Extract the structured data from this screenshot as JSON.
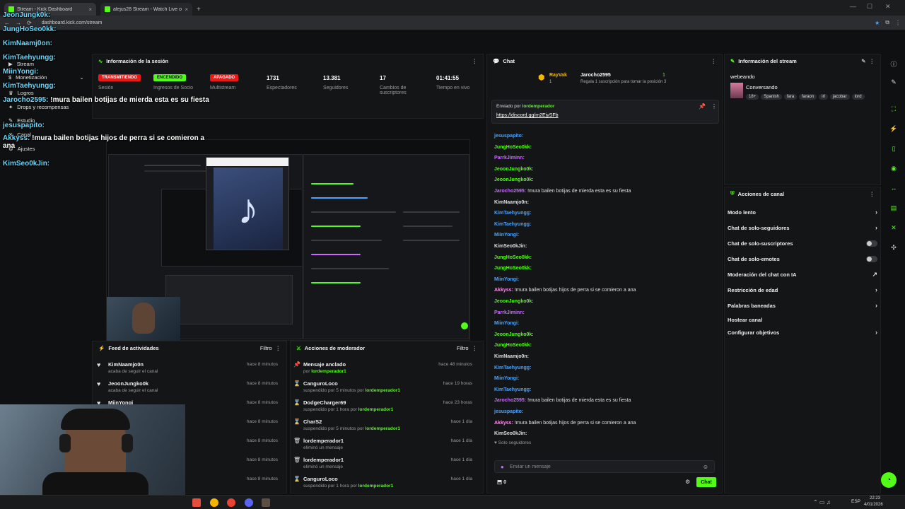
{
  "browser": {
    "tabs": [
      {
        "title": "Stream - Kick Dashboard",
        "active": true
      },
      {
        "title": "alejus28 Stream - Watch Live o...",
        "active": false
      }
    ],
    "url": "dashboard.kick.com/stream"
  },
  "session": {
    "title": "Información de la sesión",
    "stats": [
      {
        "value": "TRANSMITIENDO",
        "label": "Sesión",
        "kind": "red"
      },
      {
        "value": "ENCENDIDO",
        "label": "Ingresos de Socio",
        "kind": "grn"
      },
      {
        "value": "APAGADO",
        "label": "Multistream",
        "kind": "red"
      },
      {
        "value": "1731",
        "label": "Espectadores"
      },
      {
        "value": "13.381",
        "label": "Seguidores"
      },
      {
        "value": "17",
        "label": "Cambios de suscriptores"
      },
      {
        "value": "01:41:55",
        "label": "Tiempo en vivo"
      }
    ]
  },
  "nav": {
    "items": [
      "Stream",
      "Monetización",
      "Logros",
      "Drops y recompensas",
      "Estudio",
      "Canal",
      "Ajustes"
    ]
  },
  "overlay_chat": [
    {
      "user": "JeonJungk0k:",
      "msg": ""
    },
    {
      "user": "JungHoSeo0kk:",
      "msg": ""
    },
    {
      "user": "KimNaamj0on:",
      "msg": ""
    },
    {
      "user": "KimTaehyungg:",
      "msg": ""
    },
    {
      "user": "MiinYongi:",
      "msg": ""
    },
    {
      "user": "KimTaehyungg:",
      "msg": ""
    },
    {
      "user": "Jarocho2595:",
      "msg": "!mura bailen botijas de mierda esta es su fiesta"
    },
    {
      "user": "jesuspapito:",
      "msg": ""
    },
    {
      "user": "Akkyss:",
      "msg": "!mura bailen botijas hijos de perra si se comieron a ana"
    },
    {
      "user": "KimSeo0kJin:",
      "msg": ""
    }
  ],
  "feed": {
    "title": "Feed de actividades",
    "filter": "Filtro",
    "items": [
      {
        "name": "KimNaamjo0n",
        "sub": "acaba de seguir el canal",
        "time": "hace 8 minutos"
      },
      {
        "name": "JeoonJungko0k",
        "sub": "acaba de seguir el canal",
        "time": "hace 8 minutos"
      },
      {
        "name": "MiinYongi",
        "sub": "",
        "time": "hace 8 minutos"
      },
      {
        "name": "",
        "sub": "",
        "time": "hace 8 minutos"
      },
      {
        "name": "",
        "sub": "",
        "time": "hace 8 minutos"
      },
      {
        "name": "",
        "sub": "",
        "time": "hace 8 minutos"
      },
      {
        "name": "",
        "sub": "",
        "time": "hace 8 minutos"
      }
    ]
  },
  "mod": {
    "title": "Acciones de moderador",
    "filter": "Filtro",
    "items": [
      {
        "icon": "pin-icon",
        "name": "Mensaje anclado",
        "sub": "por",
        "who": "lordemperador1",
        "time": "hace 48 minutos"
      },
      {
        "icon": "hourglass-icon",
        "name": "CanguroLoco",
        "sub": "suspendido por 5 minutos por",
        "who": "lordemperador1",
        "time": "hace 19 horas"
      },
      {
        "icon": "hourglass-icon",
        "name": "DodgeCharger69",
        "sub": "suspendido por 1 hora por",
        "who": "lordemperador1",
        "time": "hace 23 horas"
      },
      {
        "icon": "hourglass-icon",
        "name": "CharS2",
        "sub": "suspendido por 5 minutos por",
        "who": "lordemperador1",
        "time": "hace 1 día"
      },
      {
        "icon": "trash-icon",
        "name": "lordemperador1",
        "sub": "eliminó un mensaje",
        "who": "",
        "time": "hace 1 día"
      },
      {
        "icon": "trash-icon",
        "name": "lordemperador1",
        "sub": "eliminó un mensaje",
        "who": "",
        "time": "hace 1 día"
      },
      {
        "icon": "hourglass-icon",
        "name": "CanguroLoco",
        "sub": "suspendido por 1 hora por",
        "who": "lordemperador1",
        "time": "hace 1 día"
      }
    ]
  },
  "chat": {
    "title": "Chat",
    "gifter": {
      "name": "RayVak",
      "count": "1",
      "top": "Jarocho2595",
      "top_count": "1",
      "hint": "Regala 1 suscripción para tomar la posición 3"
    },
    "pinned": {
      "label": "Enviado por",
      "by": "lordemperador",
      "link": "https://discord.gg/m2EjySFb"
    },
    "messages": [
      {
        "user": "jesuspapito:",
        "color": "#4aa3ff",
        "msg": ""
      },
      {
        "user": "JungHoSeo0kk:",
        "color": "#53fc18",
        "msg": ""
      },
      {
        "user": "ParrkJiminn:",
        "color": "#c86bff",
        "msg": ""
      },
      {
        "user": "JeoonJungko0k:",
        "color": "#53fc18",
        "msg": ""
      },
      {
        "user": "JeoonJungko0k:",
        "color": "#53fc18",
        "msg": ""
      },
      {
        "user": "Jarocho2595:",
        "color": "#c86bff",
        "msg": "!mura bailen botijas de mierda esta es su fiesta"
      },
      {
        "user": "KimNaamjo0n:",
        "color": "#e0e0e0",
        "msg": ""
      },
      {
        "user": "KimTaehyungg:",
        "color": "#4aa3ff",
        "msg": ""
      },
      {
        "user": "KimTaehyungg:",
        "color": "#4aa3ff",
        "msg": ""
      },
      {
        "user": "MiinYongi:",
        "color": "#4aa3ff",
        "msg": ""
      },
      {
        "user": "KimSeo0kJin:",
        "color": "#e0e0e0",
        "msg": ""
      },
      {
        "user": "JungHoSeo0kk:",
        "color": "#53fc18",
        "msg": ""
      },
      {
        "user": "JungHoSeo0kk:",
        "color": "#53fc18",
        "msg": ""
      },
      {
        "user": "MiinYongi:",
        "color": "#4aa3ff",
        "msg": ""
      },
      {
        "user": "Akkyss:",
        "color": "#ff8df0",
        "msg": "!mura bailen botijas hijos de perra si se comieron a ana"
      },
      {
        "user": "JeoonJungko0k:",
        "color": "#53fc18",
        "msg": ""
      },
      {
        "user": "ParrkJiminn:",
        "color": "#c86bff",
        "msg": ""
      },
      {
        "user": "MiinYongi:",
        "color": "#4aa3ff",
        "msg": ""
      },
      {
        "user": "JeoonJungko0k:",
        "color": "#53fc18",
        "msg": ""
      },
      {
        "user": "JungHoSeo0kk:",
        "color": "#53fc18",
        "msg": ""
      },
      {
        "user": "KimNaamjo0n:",
        "color": "#e0e0e0",
        "msg": ""
      },
      {
        "user": "KimTaehyungg:",
        "color": "#4aa3ff",
        "msg": ""
      },
      {
        "user": "MiinYongi:",
        "color": "#4aa3ff",
        "msg": ""
      },
      {
        "user": "KimTaehyungg:",
        "color": "#4aa3ff",
        "msg": ""
      },
      {
        "user": "Jarocho2595:",
        "color": "#c86bff",
        "msg": "!mura bailen botijas de mierda esta es su fiesta"
      },
      {
        "user": "jesuspapito:",
        "color": "#4aa3ff",
        "msg": ""
      },
      {
        "user": "Akkyss:",
        "color": "#ff8df0",
        "msg": "!mura bailen botijas hijos de perra si se comieron a ana"
      },
      {
        "user": "KimSeo0kJin:",
        "color": "#e0e0e0",
        "msg": ""
      }
    ],
    "mode": "Solo seguidores",
    "placeholder": "Enviar un mensaje",
    "counter": "0",
    "send": "Chat"
  },
  "stream_info": {
    "title": "Información del stream",
    "stream_title": "webeando",
    "category": "Conversando",
    "tags": [
      "18+",
      "Spanish",
      "fara",
      "faraon",
      "irl",
      "jacobar",
      "lord"
    ]
  },
  "channel_actions": {
    "title": "Acciones de canal",
    "items": [
      {
        "label": "Modo lento",
        "control": "chevron"
      },
      {
        "label": "Chat de solo-seguidores",
        "control": "chevron"
      },
      {
        "label": "Chat de solo-suscriptores",
        "control": "toggle"
      },
      {
        "label": "Chat de solo-emotes",
        "control": "toggle"
      },
      {
        "label": "Moderación del chat con IA",
        "control": "external"
      },
      {
        "label": "Restricción de edad",
        "control": "chevron"
      },
      {
        "label": "Palabras baneadas",
        "control": "chevron"
      },
      {
        "label": "Hostear canal",
        "control": "none"
      },
      {
        "label": "Configurar objetivos",
        "control": "chevron"
      }
    ]
  },
  "taskbar": {
    "lang": "ESP",
    "time": "22:23",
    "date": "4/01/2026"
  },
  "colors": {
    "accent": "#53fc18",
    "live": "#e91916",
    "bg": "#0f1011"
  }
}
